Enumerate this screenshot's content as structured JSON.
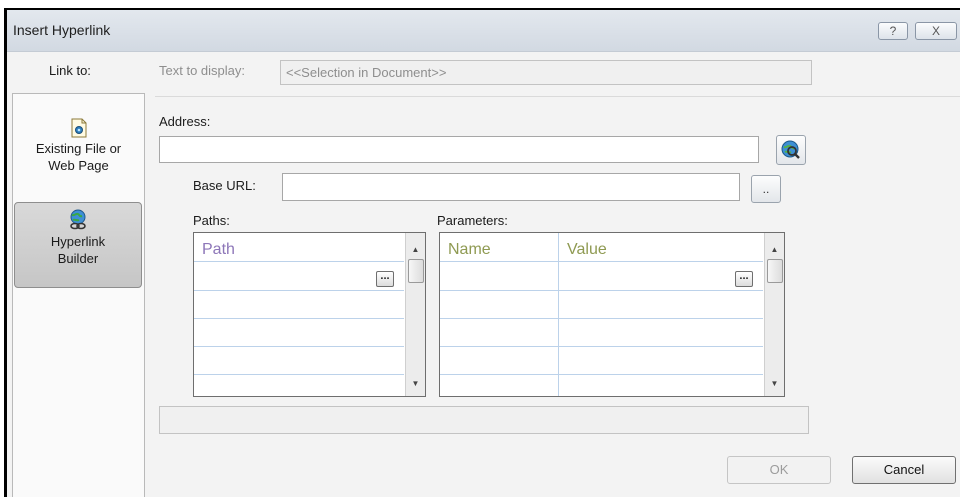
{
  "window": {
    "title": "Insert Hyperlink",
    "help_glyph": "?",
    "close_glyph": "X"
  },
  "link_to": {
    "label": "Link to:",
    "places": [
      {
        "line1": "Existing File or",
        "line2": "Web Page",
        "icon": "document-icon",
        "selected": false
      },
      {
        "line1": "Hyperlink",
        "line2": "Builder",
        "icon": "globe-link-icon",
        "selected": true
      }
    ]
  },
  "text_to_display": {
    "label": "Text to display:",
    "value": "<<Selection in Document>>"
  },
  "address": {
    "label": "Address:",
    "value": ""
  },
  "base_url": {
    "label": "Base URL:",
    "value": "",
    "browse_label": ".."
  },
  "paths": {
    "label": "Paths:",
    "columns": [
      "Path"
    ],
    "header_color": "#8d76b8",
    "ellipsis": "..."
  },
  "parameters": {
    "label": "Parameters:",
    "columns": [
      "Name",
      "Value"
    ],
    "header_color": "#8f9a52",
    "ellipsis": "..."
  },
  "buttons": {
    "ok": "OK",
    "cancel": "Cancel"
  }
}
